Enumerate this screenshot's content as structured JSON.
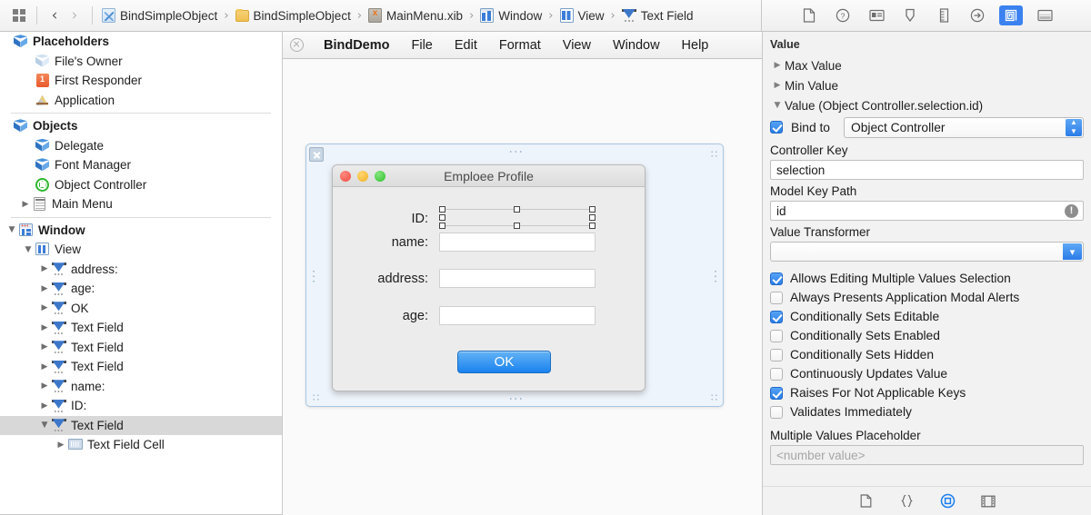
{
  "topbar": {
    "grid_icon": "grid-icon",
    "back_label": "‹",
    "forward_label": "›",
    "breadcrumb": [
      {
        "label": "BindSimpleObject",
        "icon": "xib-project-icon"
      },
      {
        "label": "BindSimpleObject",
        "icon": "folder-icon"
      },
      {
        "label": "MainMenu.xib",
        "icon": "xml-file-icon"
      },
      {
        "label": "Window",
        "icon": "window-icon"
      },
      {
        "label": "View",
        "icon": "view-icon"
      },
      {
        "label": "Text Field",
        "icon": "text-field-icon"
      }
    ],
    "separator": "›"
  },
  "sidebar": {
    "groups": [
      {
        "header": {
          "label": "Placeholders",
          "icon": "cube-icon",
          "indent": 0,
          "disclosure": "none"
        },
        "items": [
          {
            "label": "File's Owner",
            "icon": "cube-pale-icon",
            "indent": 1,
            "disclosure": "none"
          },
          {
            "label": "First Responder",
            "icon": "responder-icon",
            "indent": 1,
            "disclosure": "none"
          },
          {
            "label": "Application",
            "icon": "app-icon",
            "indent": 1,
            "disclosure": "none"
          }
        ]
      },
      {
        "header": {
          "label": "Objects",
          "icon": "cube-icon",
          "indent": 0,
          "disclosure": "none"
        },
        "items": [
          {
            "label": "Delegate",
            "icon": "cube-solid-icon",
            "indent": 1,
            "disclosure": "none"
          },
          {
            "label": "Font Manager",
            "icon": "cube-solid-icon",
            "indent": 1,
            "disclosure": "none"
          },
          {
            "label": "Object Controller",
            "icon": "object-controller-icon",
            "indent": 1,
            "disclosure": "none"
          },
          {
            "label": "Main Menu",
            "icon": "menu-list-icon",
            "indent": 1,
            "disclosure": "collapsed"
          }
        ]
      }
    ],
    "tree": [
      {
        "label": "Window",
        "icon": "window-icon",
        "indent": 0,
        "disclosure": "expanded",
        "bold": true,
        "selected": false
      },
      {
        "label": "View",
        "icon": "view-icon",
        "indent": 1,
        "disclosure": "expanded",
        "bold": false,
        "selected": false
      },
      {
        "label": "address:",
        "icon": "text-field-icon",
        "indent": 2,
        "disclosure": "collapsed",
        "bold": false,
        "selected": false
      },
      {
        "label": "age:",
        "icon": "text-field-icon",
        "indent": 2,
        "disclosure": "collapsed",
        "bold": false,
        "selected": false
      },
      {
        "label": "OK",
        "icon": "text-field-icon",
        "indent": 2,
        "disclosure": "collapsed",
        "bold": false,
        "selected": false
      },
      {
        "label": "Text Field",
        "icon": "text-field-icon",
        "indent": 2,
        "disclosure": "collapsed",
        "bold": false,
        "selected": false
      },
      {
        "label": "Text Field",
        "icon": "text-field-icon",
        "indent": 2,
        "disclosure": "collapsed",
        "bold": false,
        "selected": false
      },
      {
        "label": "Text Field",
        "icon": "text-field-icon",
        "indent": 2,
        "disclosure": "collapsed",
        "bold": false,
        "selected": false
      },
      {
        "label": "name:",
        "icon": "text-field-icon",
        "indent": 2,
        "disclosure": "collapsed",
        "bold": false,
        "selected": false
      },
      {
        "label": "ID:",
        "icon": "text-field-icon",
        "indent": 2,
        "disclosure": "collapsed",
        "bold": false,
        "selected": false
      },
      {
        "label": "Text Field",
        "icon": "text-field-icon",
        "indent": 2,
        "disclosure": "expanded",
        "bold": false,
        "selected": true
      },
      {
        "label": "Text Field Cell",
        "icon": "cell-icon",
        "indent": 3,
        "disclosure": "collapsed",
        "bold": false,
        "selected": false
      }
    ]
  },
  "menubar": {
    "close_icon": "close-icon",
    "items": [
      {
        "label": "BindDemo",
        "bold": true
      },
      {
        "label": "File",
        "bold": false
      },
      {
        "label": "Edit",
        "bold": false
      },
      {
        "label": "Format",
        "bold": false
      },
      {
        "label": "View",
        "bold": false
      },
      {
        "label": "Window",
        "bold": false
      },
      {
        "label": "Help",
        "bold": false
      }
    ]
  },
  "canvas": {
    "window": {
      "title": "Emploee Profile",
      "fields": [
        {
          "label": "ID:",
          "value": "",
          "selected": true
        },
        {
          "label": "name:",
          "value": "",
          "selected": false
        },
        {
          "label": "address:",
          "value": "",
          "selected": false
        },
        {
          "label": "age:",
          "value": "",
          "selected": false
        }
      ],
      "ok_button": "OK"
    }
  },
  "inspector": {
    "toolbar": [
      {
        "name": "file-inspector-icon",
        "active": false
      },
      {
        "name": "quick-help-icon",
        "active": false
      },
      {
        "name": "identity-inspector-icon",
        "active": false
      },
      {
        "name": "attributes-inspector-icon",
        "active": false
      },
      {
        "name": "size-inspector-icon",
        "active": false
      },
      {
        "name": "connections-inspector-icon",
        "active": false
      },
      {
        "name": "bindings-inspector-icon",
        "active": true
      },
      {
        "name": "view-effects-icon",
        "active": false
      }
    ],
    "section_title": "Value",
    "collapsed_rows": [
      {
        "label": "Max Value",
        "disclosure": "collapsed"
      },
      {
        "label": "Min Value",
        "disclosure": "collapsed"
      }
    ],
    "expanded_row": {
      "label": "Value (Object Controller.selection.id)",
      "disclosure": "expanded"
    },
    "bind_to": {
      "label": "Bind to",
      "checked": true,
      "value": "Object Controller"
    },
    "controller_key": {
      "label": "Controller Key",
      "value": "selection"
    },
    "model_key_path": {
      "label": "Model Key Path",
      "value": "id",
      "warning": "!"
    },
    "value_transformer": {
      "label": "Value Transformer",
      "value": ""
    },
    "options": [
      {
        "label": "Allows Editing Multiple Values Selection",
        "checked": true
      },
      {
        "label": "Always Presents Application Modal Alerts",
        "checked": false
      },
      {
        "label": "Conditionally Sets Editable",
        "checked": true
      },
      {
        "label": "Conditionally Sets Enabled",
        "checked": false
      },
      {
        "label": "Conditionally Sets Hidden",
        "checked": false
      },
      {
        "label": "Continuously Updates Value",
        "checked": false
      },
      {
        "label": "Raises For Not Applicable Keys",
        "checked": true
      },
      {
        "label": "Validates Immediately",
        "checked": false
      }
    ],
    "placeholder_field": {
      "label": "Multiple Values Placeholder",
      "placeholder": "<number value>",
      "value": ""
    },
    "footer_tools": [
      {
        "name": "file-template-icon",
        "active": false
      },
      {
        "name": "code-snippet-icon",
        "active": false
      },
      {
        "name": "object-library-icon",
        "active": true
      },
      {
        "name": "media-library-icon",
        "active": false
      }
    ]
  },
  "colors": {
    "accent": "#3b82f0",
    "selection_row": "#d8d8d8",
    "inspector_bg": "#f2f2f2"
  }
}
